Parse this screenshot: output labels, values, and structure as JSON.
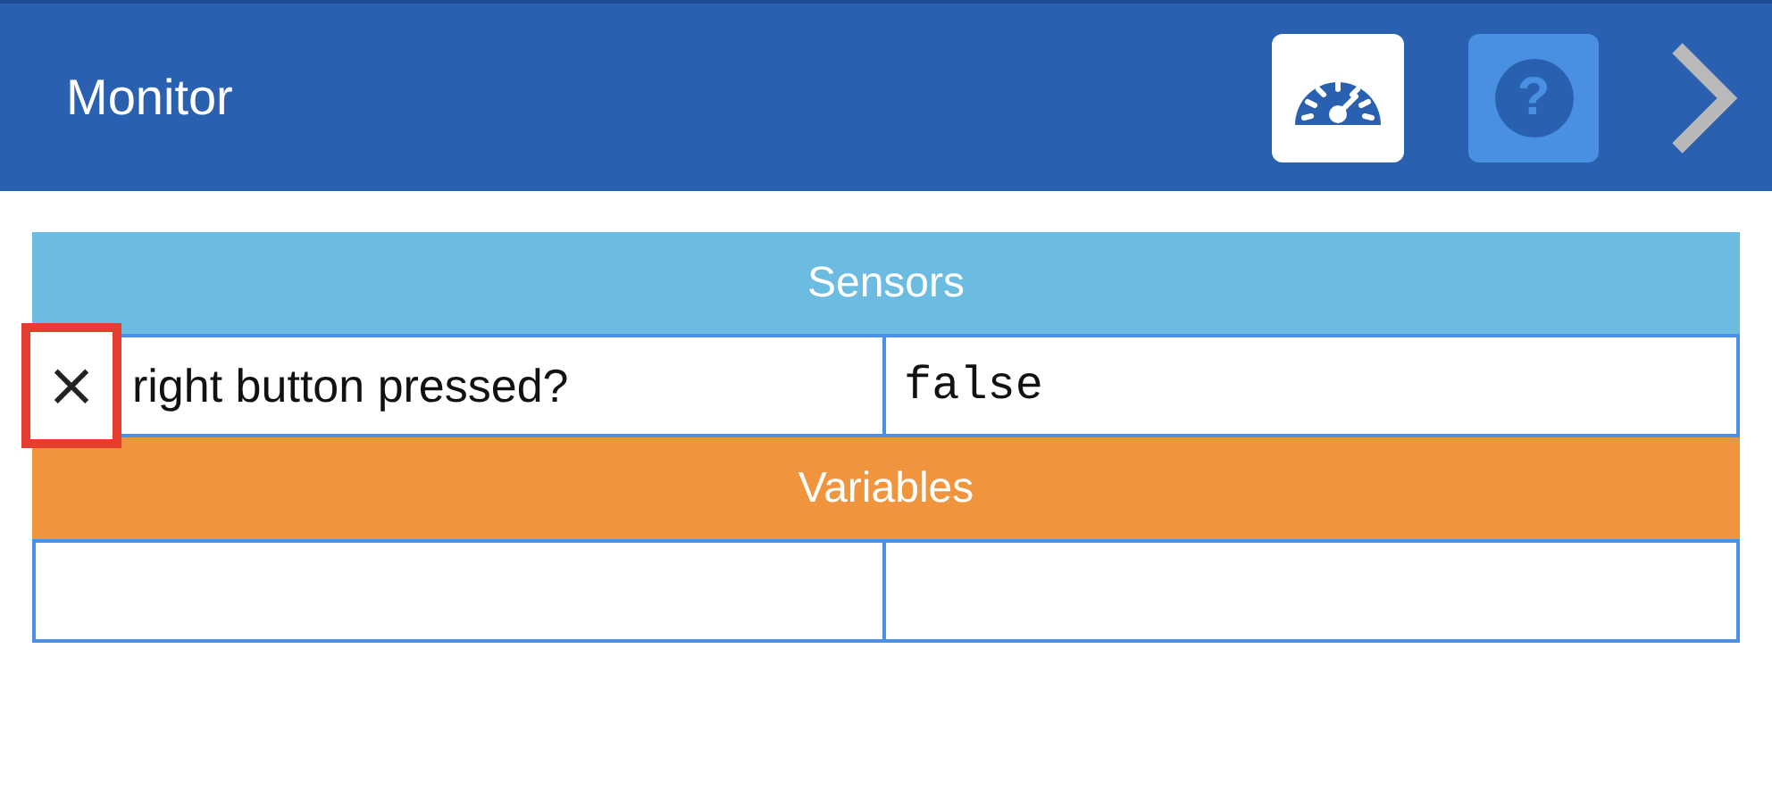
{
  "header": {
    "title": "Monitor",
    "help_label": "?"
  },
  "sections": [
    {
      "title": "Sensors",
      "color": "#6cbce2",
      "rows": [
        {
          "name": "right button pressed?",
          "value": "false",
          "remove_label": "×"
        }
      ]
    },
    {
      "title": "Variables",
      "color": "#f0953d"
    }
  ]
}
